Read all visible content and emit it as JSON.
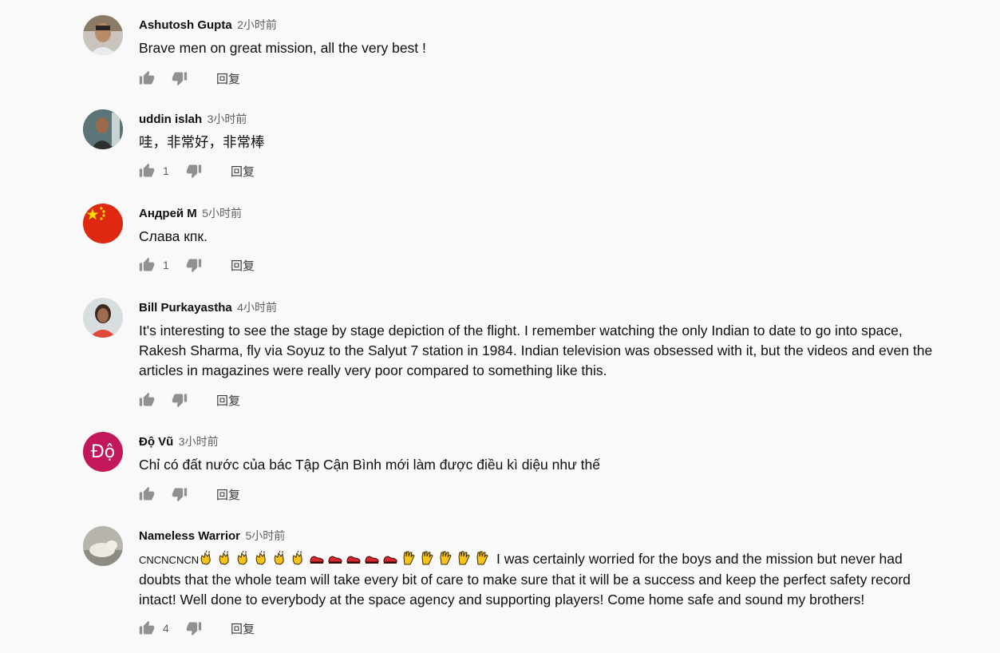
{
  "comments": [
    {
      "author": "Ashutosh Gupta",
      "time": "2小时前",
      "text": "Brave men on great mission, all the very best !",
      "likes": "",
      "reply": "回复"
    },
    {
      "author": "uddin islah",
      "time": "3小时前",
      "text": "哇，非常好，非常棒",
      "likes": "1",
      "reply": "回复"
    },
    {
      "author": "Андрей М",
      "time": "5小时前",
      "text": "Слава кпк.",
      "likes": "1",
      "reply": "回复"
    },
    {
      "author": "Bill Purkayastha",
      "time": "4小时前",
      "text": "It's interesting to see the stage by stage depiction of the flight. I remember watching the only Indian to date to go into space, Rakesh Sharma, fly via Soyuz to the Salyut 7 station in 1984. Indian television was obsessed with it,  but the videos and even the articles in magazines were really very poor compared to something like this.",
      "likes": "",
      "reply": "回复"
    },
    {
      "author": "Độ Vũ",
      "time": "3小时前",
      "text": "Chỉ có đất nước của bác Tập Cận Bình mới làm được điều kì diệu như thế",
      "likes": "",
      "reply": "回复",
      "avatar_letter": "Độ"
    },
    {
      "author": "Nameless Warrior",
      "time": "5小时前",
      "prefix": "CNCNCNCN",
      "text": " I was certainly worried for the boys and the mission but never had doubts that the whole team will take every bit of care to make sure that it will be a success and keep the perfect safety record intact! Well done to everybody at the space agency and supporting players! Come home safe and sound my brothers!",
      "likes": "4",
      "reply": "回复"
    }
  ],
  "emojis": [
    "clap-emoji",
    "clap-emoji",
    "clap-emoji",
    "clap-emoji",
    "clap-emoji",
    "clap-emoji",
    "shoe-emoji",
    "shoe-emoji",
    "shoe-emoji",
    "shoe-emoji",
    "shoe-emoji",
    "vulcan-emoji",
    "vulcan-emoji",
    "vulcan-emoji",
    "vulcan-emoji",
    "vulcan-emoji"
  ],
  "colors": {
    "author": "#0f0f0f",
    "time": "#606060",
    "icon": "#909090",
    "avatar_red": "#c2185b",
    "flag_red": "#de2910",
    "flag_yellow": "#ffde00"
  }
}
